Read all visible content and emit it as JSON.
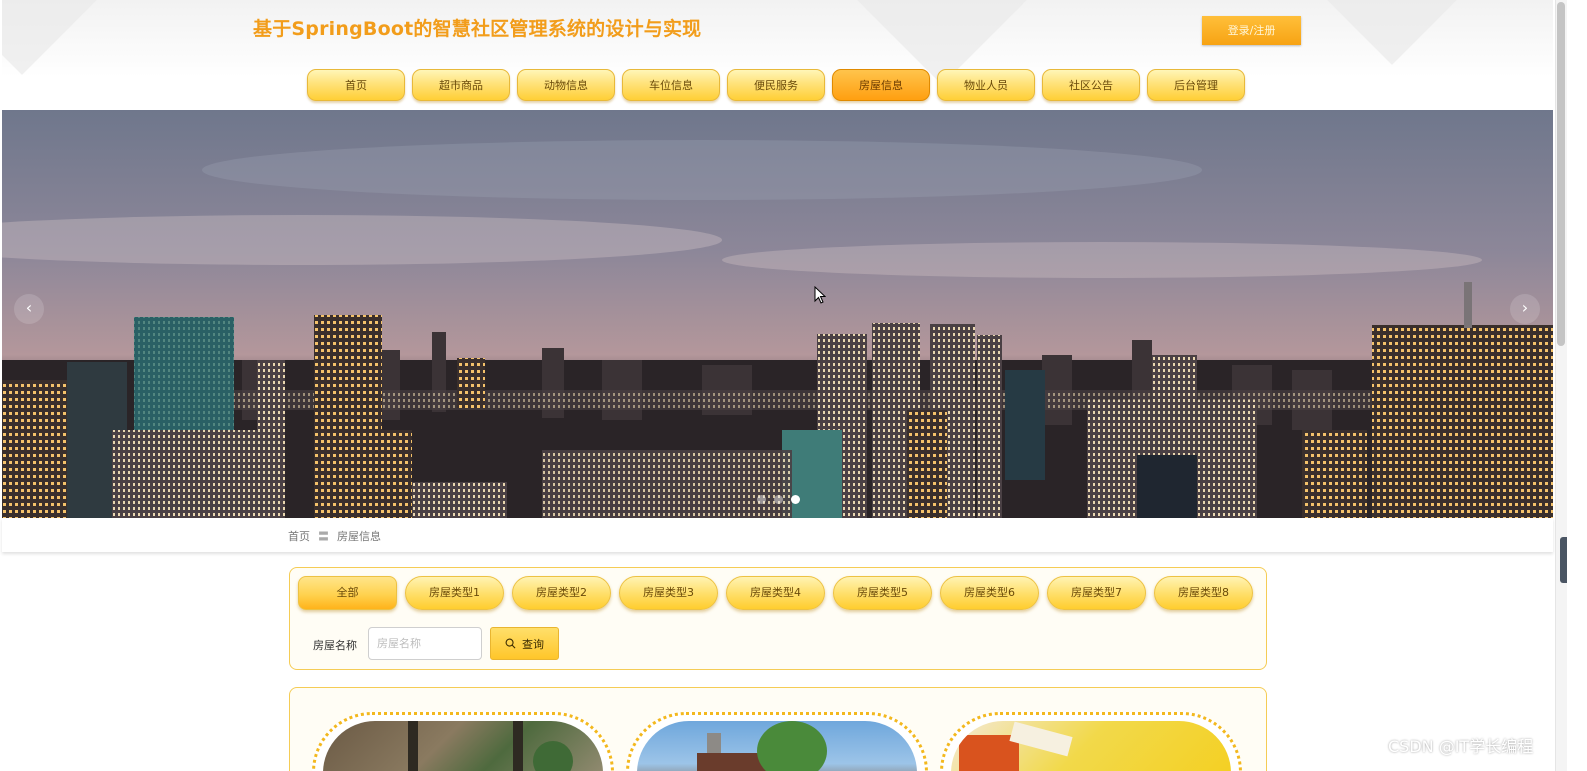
{
  "header": {
    "site_title": "基于SpringBoot的智慧社区管理系统的设计与实现",
    "login_label": "登录/注册"
  },
  "nav": {
    "items": [
      {
        "label": "首页"
      },
      {
        "label": "超市商品"
      },
      {
        "label": "动物信息"
      },
      {
        "label": "车位信息"
      },
      {
        "label": "便民服务"
      },
      {
        "label": "房屋信息",
        "active": true
      },
      {
        "label": "物业人员"
      },
      {
        "label": "社区公告"
      },
      {
        "label": "后台管理"
      }
    ]
  },
  "banner": {
    "prev_icon": "‹",
    "next_icon": "›",
    "slide_count": 3,
    "active_slide": 3
  },
  "breadcrumb": {
    "home": "首页",
    "separator": "〓",
    "current": "房屋信息"
  },
  "filter": {
    "categories": [
      {
        "label": "全部",
        "active": true
      },
      {
        "label": "房屋类型1"
      },
      {
        "label": "房屋类型2"
      },
      {
        "label": "房屋类型3"
      },
      {
        "label": "房屋类型4"
      },
      {
        "label": "房屋类型5"
      },
      {
        "label": "房屋类型6"
      },
      {
        "label": "房屋类型7"
      },
      {
        "label": "房屋类型8"
      }
    ],
    "search_label": "房屋名称",
    "search_placeholder": "房屋名称",
    "search_button": "查询",
    "search_icon": "search-icon"
  },
  "listing": {
    "cards": [
      {
        "image": "house-photo-1"
      },
      {
        "image": "house-photo-2"
      },
      {
        "image": "house-photo-3"
      }
    ]
  },
  "watermark": "CSDN @IT学长编程",
  "colors": {
    "accent": "#f29d1b",
    "nav_active": "#ff9f10",
    "nav_base": "#ffe27a",
    "panel_border": "#f5cc55"
  }
}
